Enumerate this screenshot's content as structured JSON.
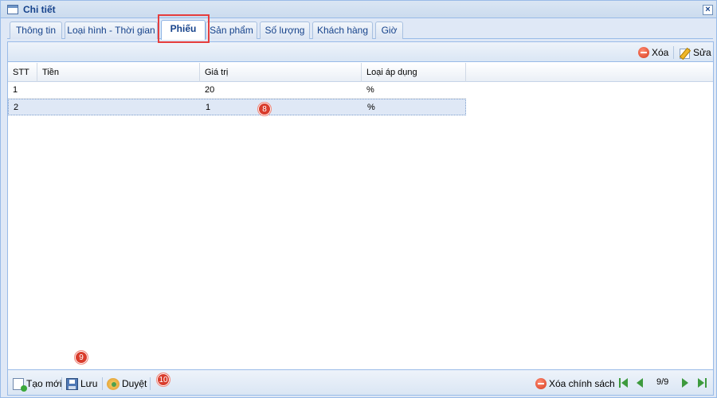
{
  "window": {
    "title": "Chi tiết"
  },
  "tabs": [
    {
      "label": "Thông tin"
    },
    {
      "label": "Loại hình - Thời gian"
    },
    {
      "label": "Phiếu"
    },
    {
      "label": "Sản phẩm"
    },
    {
      "label": "Số lượng"
    },
    {
      "label": "Khách hàng"
    },
    {
      "label": "Giờ"
    }
  ],
  "active_tab": "Phiếu",
  "toolbar": {
    "delete_label": "Xóa",
    "edit_label": "Sửa"
  },
  "grid": {
    "columns": [
      "STT",
      "Tiền",
      "Giá trị",
      "Loại áp dụng"
    ],
    "rows": [
      {
        "stt": "1",
        "tien": "",
        "gia_tri": "20",
        "loai": "%"
      },
      {
        "stt": "2",
        "tien": "",
        "gia_tri": "1",
        "loai": "%"
      }
    ],
    "selected_row": 2
  },
  "badges": {
    "b8": "8",
    "b9": "9",
    "b10": "10"
  },
  "bottom": {
    "new_label": "Tạo mới",
    "save_label": "Lưu",
    "approve_label": "Duyệt",
    "delete_policy_label": "Xóa chính sách",
    "page_info": "9/9"
  },
  "colors": {
    "accent": "#15428b",
    "highlight": "#e53d3d",
    "selected_row": "#dfe8f6",
    "badge": "#d93c2c"
  }
}
